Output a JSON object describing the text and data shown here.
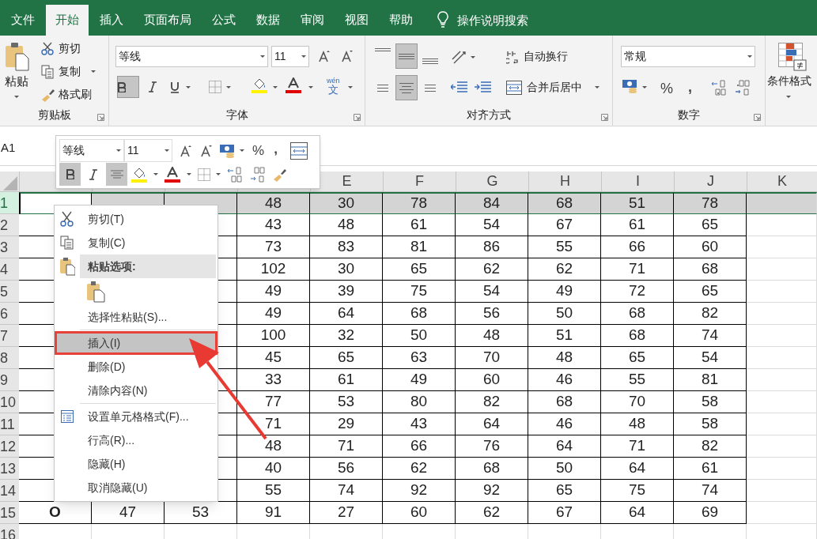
{
  "tabs": [
    {
      "label": "文件",
      "selected": false
    },
    {
      "label": "开始",
      "selected": true
    },
    {
      "label": "插入",
      "selected": false
    },
    {
      "label": "页面布局",
      "selected": false
    },
    {
      "label": "公式",
      "selected": false
    },
    {
      "label": "数据",
      "selected": false
    },
    {
      "label": "审阅",
      "selected": false
    },
    {
      "label": "视图",
      "selected": false
    },
    {
      "label": "帮助",
      "selected": false
    }
  ],
  "tell_me": "操作说明搜索",
  "ribbon": {
    "clipboard": {
      "paste": "粘贴",
      "cut": "剪切",
      "copy": "复制",
      "format_painter": "格式刷",
      "label": "剪贴板"
    },
    "font": {
      "font_name": "等线",
      "font_size": "11",
      "bold": true,
      "phonetic": "wén",
      "phonetic_char": "文",
      "label": "字体"
    },
    "alignment": {
      "middle_align": true,
      "center": true,
      "wrap_text": "自动换行",
      "merge_center": "合并后居中",
      "label": "对齐方式"
    },
    "number": {
      "format": "常规",
      "percent": "%",
      "comma": ",",
      "label": "数字"
    },
    "conditional_format": "条件格式"
  },
  "name_box": "A1",
  "mini_toolbar": {
    "font_name": "等线",
    "font_size": "11",
    "percent": "%",
    "comma": ",",
    "bold": true,
    "center": true
  },
  "columns": [
    "E",
    "F",
    "G",
    "H",
    "I",
    "J",
    "K"
  ],
  "rows": [
    {
      "header": "1",
      "selected": true,
      "cells": [
        "48",
        "30",
        "78",
        "84",
        "68",
        "51",
        "78"
      ]
    },
    {
      "header": "2",
      "selected": false,
      "cells": [
        "43",
        "48",
        "61",
        "54",
        "67",
        "61",
        "65"
      ]
    },
    {
      "header": "3",
      "selected": false,
      "cells": [
        "73",
        "83",
        "81",
        "86",
        "55",
        "66",
        "60"
      ]
    },
    {
      "header": "4",
      "selected": false,
      "cells": [
        "102",
        "30",
        "65",
        "62",
        "62",
        "71",
        "68"
      ]
    },
    {
      "header": "5",
      "selected": false,
      "cells": [
        "49",
        "39",
        "75",
        "54",
        "49",
        "72",
        "65"
      ]
    },
    {
      "header": "6",
      "selected": false,
      "cells": [
        "49",
        "64",
        "68",
        "56",
        "50",
        "68",
        "82"
      ]
    },
    {
      "header": "7",
      "selected": false,
      "cells": [
        "100",
        "32",
        "50",
        "48",
        "51",
        "68",
        "74"
      ]
    },
    {
      "header": "8",
      "selected": false,
      "cells": [
        "45",
        "65",
        "63",
        "70",
        "48",
        "65",
        "54"
      ]
    },
    {
      "header": "9",
      "selected": false,
      "cells": [
        "33",
        "61",
        "49",
        "60",
        "46",
        "55",
        "81"
      ]
    },
    {
      "header": "10",
      "selected": false,
      "cells": [
        "77",
        "53",
        "80",
        "82",
        "68",
        "70",
        "58"
      ]
    },
    {
      "header": "11",
      "selected": false,
      "cells": [
        "71",
        "29",
        "43",
        "64",
        "46",
        "48",
        "58"
      ]
    },
    {
      "header": "12",
      "selected": false,
      "cells": [
        "48",
        "71",
        "66",
        "76",
        "64",
        "71",
        "82"
      ]
    },
    {
      "header": "13",
      "selected": false,
      "cells": [
        "40",
        "56",
        "62",
        "68",
        "50",
        "64",
        "61"
      ]
    },
    {
      "header": "14",
      "selected": false,
      "cells": [
        "55",
        "74",
        "92",
        "92",
        "65",
        "75",
        "74"
      ]
    },
    {
      "header": "15",
      "selected": false,
      "cells": [
        "O",
        "47",
        "53",
        "91",
        "27",
        "60",
        "62",
        "67",
        "64",
        "69"
      ]
    },
    {
      "header": "16",
      "selected": false,
      "cells": []
    }
  ],
  "context_menu": [
    {
      "kind": "cut",
      "label": "剪切(T)",
      "selected": false
    },
    {
      "kind": "copy",
      "label": "复制(C)",
      "selected": false
    },
    {
      "kind": "paste-header",
      "label": "粘贴选项:",
      "selected": false
    },
    {
      "kind": "paste-option"
    },
    {
      "kind": "plain",
      "label": "选择性粘贴(S)...",
      "selected": false
    },
    {
      "kind": "separator"
    },
    {
      "kind": "plain",
      "label": "插入(I)",
      "selected": true
    },
    {
      "kind": "plain",
      "label": "删除(D)",
      "selected": false
    },
    {
      "kind": "plain",
      "label": "清除内容(N)",
      "selected": false
    },
    {
      "kind": "separator"
    },
    {
      "kind": "format",
      "label": "设置单元格格式(F)...",
      "selected": false
    },
    {
      "kind": "plain",
      "label": "行高(R)...",
      "selected": false
    },
    {
      "kind": "plain",
      "label": "隐藏(H)",
      "selected": false
    },
    {
      "kind": "plain",
      "label": "取消隐藏(U)",
      "selected": false
    }
  ]
}
